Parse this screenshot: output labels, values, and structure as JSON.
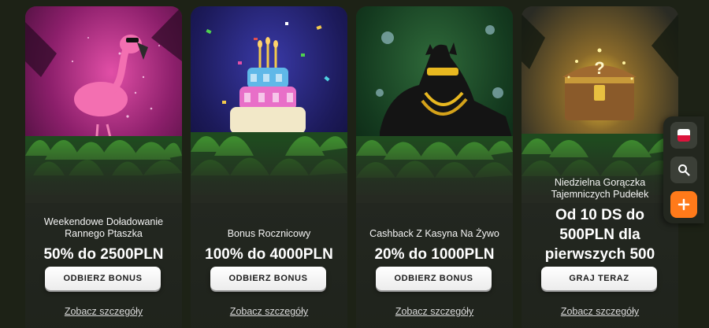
{
  "promotions": [
    {
      "subtitle": "Weekendowe Doładowanie Rannego Ptaszka",
      "headline": "50% do 2500PLN",
      "button_label": "ODBIERZ BONUS",
      "details_label": "Zobacz szczegóły",
      "art_icon": "flamingo-icon"
    },
    {
      "subtitle": "Bonus Rocznicowy",
      "headline": "100% do 4000PLN",
      "button_label": "ODBIERZ BONUS",
      "details_label": "Zobacz szczegóły",
      "art_icon": "birthday-cake-icon"
    },
    {
      "subtitle": "Cashback Z Kasyna Na Żywo",
      "headline": "20% do 1000PLN",
      "button_label": "ODBIERZ BONUS",
      "details_label": "Zobacz szczegóły",
      "art_icon": "panther-icon"
    },
    {
      "subtitle": "Niedzielna Gorączka Tajemniczych Pudełek",
      "headline": "Od 10 DS do 500PLN dla pierwszych 500",
      "button_label": "GRAJ TERAZ",
      "details_label": "Zobacz szczegóły",
      "art_icon": "treasure-chest-icon"
    }
  ],
  "side_panel": {
    "language_icon": "poland-flag-icon",
    "search_icon": "search-icon",
    "plus_icon": "plus-icon"
  },
  "colors": {
    "page_background": "#1d2216",
    "card_background": "#262a22",
    "button_background": "#ffffff",
    "button_text": "#1c1c1c",
    "accent_orange": "#ff7a1a"
  }
}
